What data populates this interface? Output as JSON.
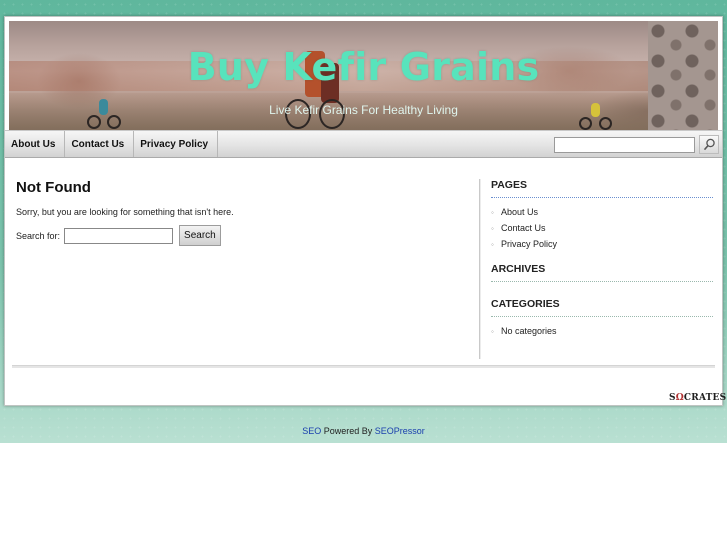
{
  "site": {
    "title": "Buy Kefir Grains",
    "tagline": "Live Kefir Grains For Healthy Living"
  },
  "nav": {
    "items": [
      "About Us",
      "Contact Us",
      "Privacy Policy"
    ],
    "search_placeholder": ""
  },
  "main": {
    "heading": "Not Found",
    "message": "Sorry, but you are looking for something that isn't here.",
    "search_label": "Search for:",
    "search_button": "Search"
  },
  "sidebar": {
    "pages_heading": "PAGES",
    "pages": [
      "About Us",
      "Contact Us",
      "Privacy Policy"
    ],
    "archives_heading": "ARCHIVES",
    "categories_heading": "CATEGORIES",
    "categories": [
      "No categories"
    ]
  },
  "footer": {
    "theme_logo_prefix": "S",
    "theme_logo_omega": "Ω",
    "theme_logo_suffix": "CRATES",
    "credit_link1": "SEO",
    "credit_text": " Powered By ",
    "credit_link2": "SEOPressor"
  },
  "colors": {
    "title": "#58e3bc",
    "background_top": "#5fb79d",
    "link": "#1a3fae"
  },
  "icons": [
    "magnifier-icon"
  ]
}
